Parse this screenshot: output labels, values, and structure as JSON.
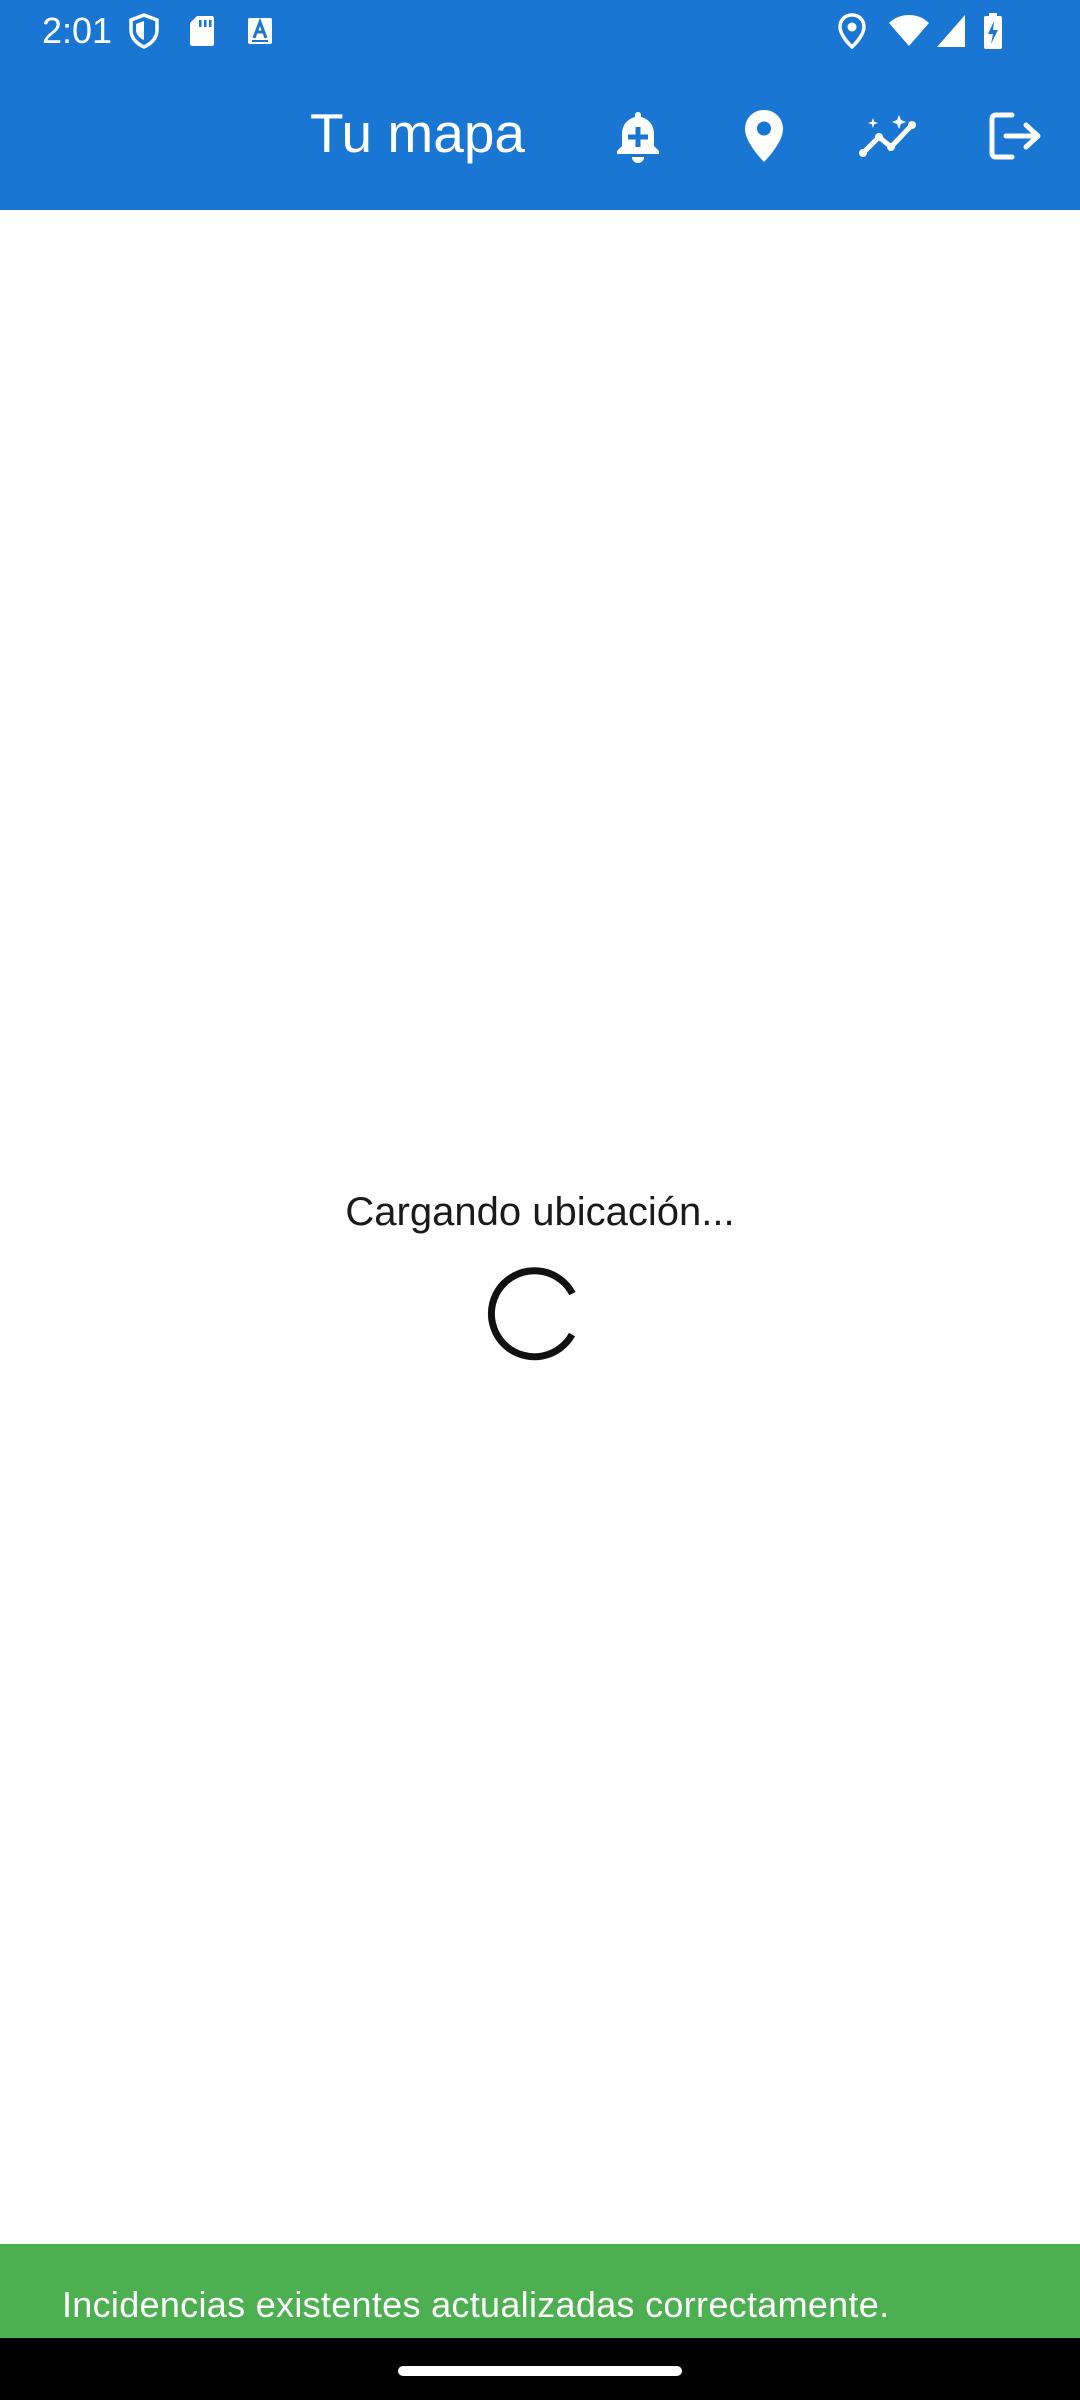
{
  "status_bar": {
    "time": "2:01",
    "left_icons": [
      "shield-icon",
      "sd-card-icon",
      "keyboard-a-icon"
    ],
    "right_icons": [
      "location-icon",
      "wifi-icon",
      "signal-icon",
      "battery-charging-icon"
    ]
  },
  "app_bar": {
    "title": "Tu mapa",
    "background_color": "#1976d2",
    "actions": [
      {
        "name": "notification-add-icon"
      },
      {
        "name": "location-pin-icon"
      },
      {
        "name": "insights-icon"
      },
      {
        "name": "logout-icon"
      }
    ]
  },
  "content": {
    "loading_text": "Cargando ubicación...",
    "spinner_icon": "progress-spinner-icon"
  },
  "snackbar": {
    "message": "Incidencias existentes actualizadas correctamente.",
    "background_color": "#4caf50"
  },
  "nav_bar": {
    "handle": "gesture-handle"
  }
}
